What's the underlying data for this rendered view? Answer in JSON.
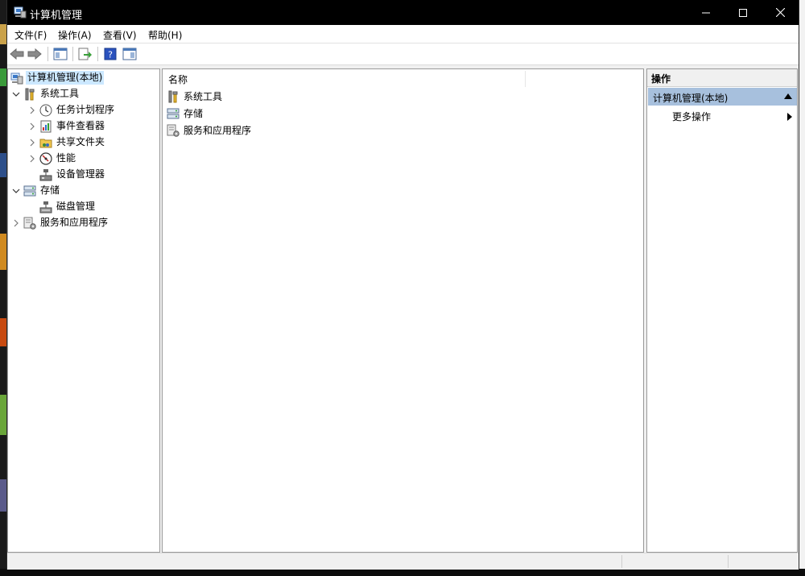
{
  "window": {
    "title": "计算机管理"
  },
  "menubar": [
    "文件(F)",
    "操作(A)",
    "查看(V)",
    "帮助(H)"
  ],
  "toolbar": [
    {
      "name": "back-arrow-icon"
    },
    {
      "name": "forward-arrow-icon"
    },
    {
      "name": "show-hide-console-tree-icon"
    },
    {
      "name": "export-list-icon"
    },
    {
      "name": "help-icon"
    },
    {
      "name": "show-hide-action-pane-icon"
    }
  ],
  "tree": {
    "root": "计算机管理(本地)",
    "system_tools": "系统工具",
    "task_scheduler": "任务计划程序",
    "event_viewer": "事件查看器",
    "shared_folders": "共享文件夹",
    "performance": "性能",
    "device_manager": "设备管理器",
    "storage": "存储",
    "disk_management": "磁盘管理",
    "services_apps": "服务和应用程序"
  },
  "center": {
    "column_name": "名称",
    "items": [
      "系统工具",
      "存储",
      "服务和应用程序"
    ]
  },
  "actions": {
    "title": "操作",
    "group": "计算机管理(本地)",
    "more": "更多操作"
  },
  "colors": {
    "selection": "#cce8ff",
    "action_group": "#a7c0dd",
    "titlebar": "#000000"
  }
}
